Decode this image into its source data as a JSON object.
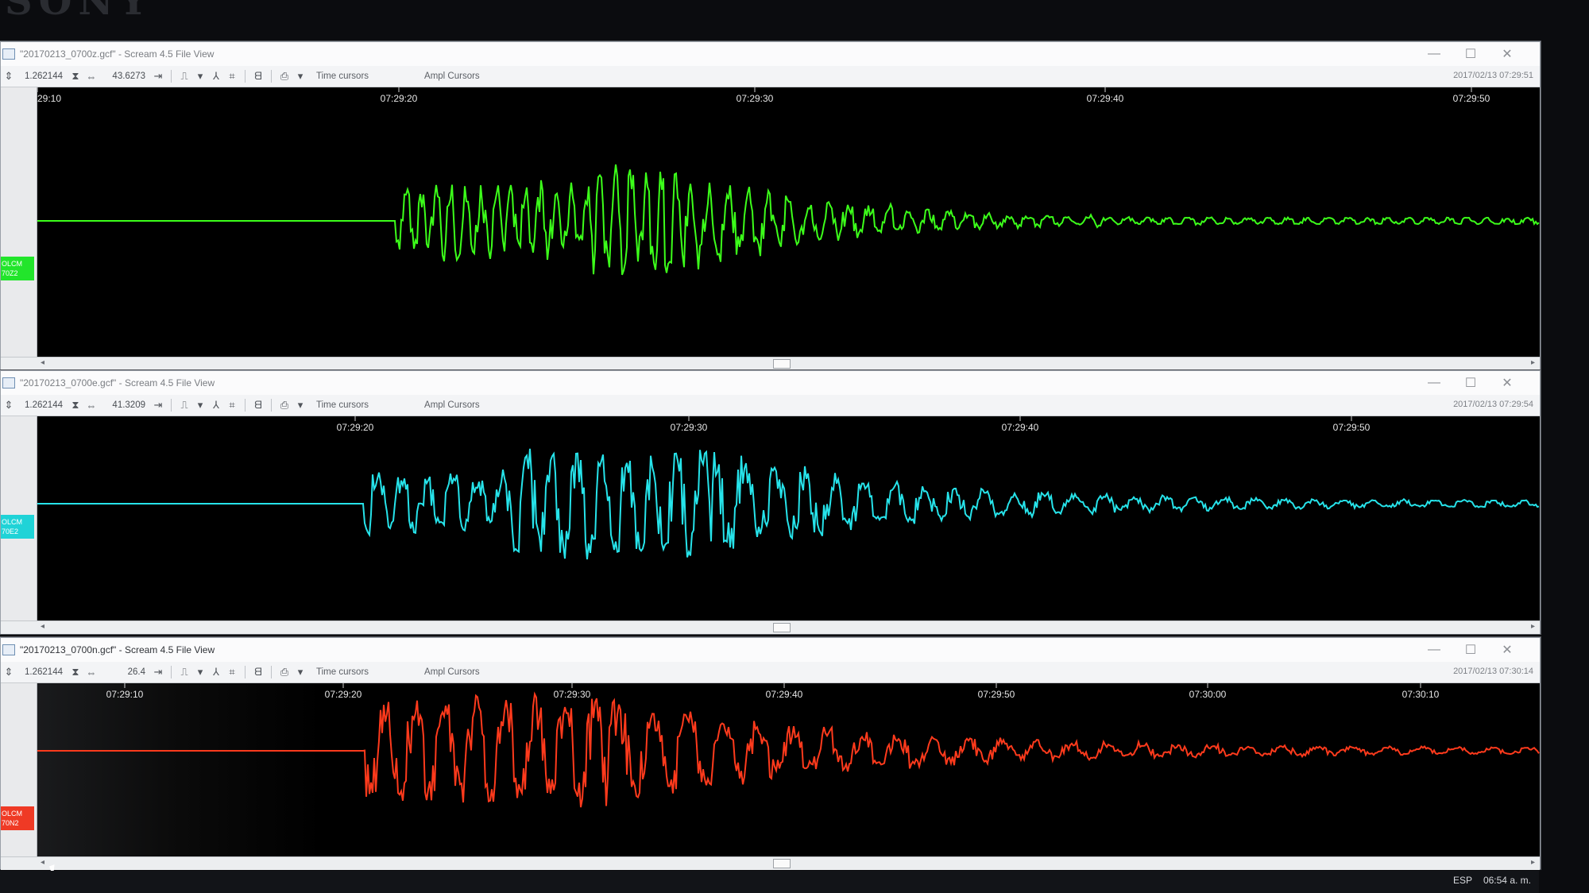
{
  "bezel": {
    "brand": "SONY"
  },
  "windows": [
    {
      "title": "\"20170213_0700z.gcf\" - Scream 4.5 File View",
      "toolbar": {
        "gain": "1.262144",
        "scale": "43.6273",
        "time_cursors": "Time cursors",
        "ampl_cursors": "Ampl Cursors",
        "timestamp": "2017/02/13 07:29:51"
      },
      "channel": {
        "line1": "OLCM",
        "line2": "70Z2",
        "color": "#22e52b"
      },
      "trace_color": "#3cff1a",
      "ticks": [
        "29:10",
        "07:29:20",
        "07:29:30",
        "07:29:40",
        "07:29:50"
      ]
    },
    {
      "title": "\"20170213_0700e.gcf\" - Scream 4.5 File View",
      "toolbar": {
        "gain": "1.262144",
        "scale": "41.3209",
        "time_cursors": "Time cursors",
        "ampl_cursors": "Ampl Cursors",
        "timestamp": "2017/02/13 07:29:54"
      },
      "channel": {
        "line1": "OLCM",
        "line2": "70E2",
        "color": "#1fd3d7"
      },
      "trace_color": "#26e3ea",
      "ticks": [
        "07:29:20",
        "07:29:30",
        "07:29:40",
        "07:29:50"
      ]
    },
    {
      "title": "\"20170213_0700n.gcf\" - Scream 4.5 File View",
      "toolbar": {
        "gain": "1.262144",
        "scale": "26.4",
        "time_cursors": "Time cursors",
        "ampl_cursors": "Ampl Cursors",
        "timestamp": "2017/02/13 07:30:14"
      },
      "channel": {
        "line1": "OLCM",
        "line2": "70N2",
        "color": "#ef3a25"
      },
      "trace_color": "#ff3a1c",
      "ticks": [
        "07:29:10",
        "07:29:20",
        "07:29:30",
        "07:29:40",
        "07:29:50",
        "07:30:00",
        "07:30:10"
      ]
    }
  ],
  "taskbar": {
    "clock": "06:54 a. m.",
    "lang": "ESP"
  }
}
